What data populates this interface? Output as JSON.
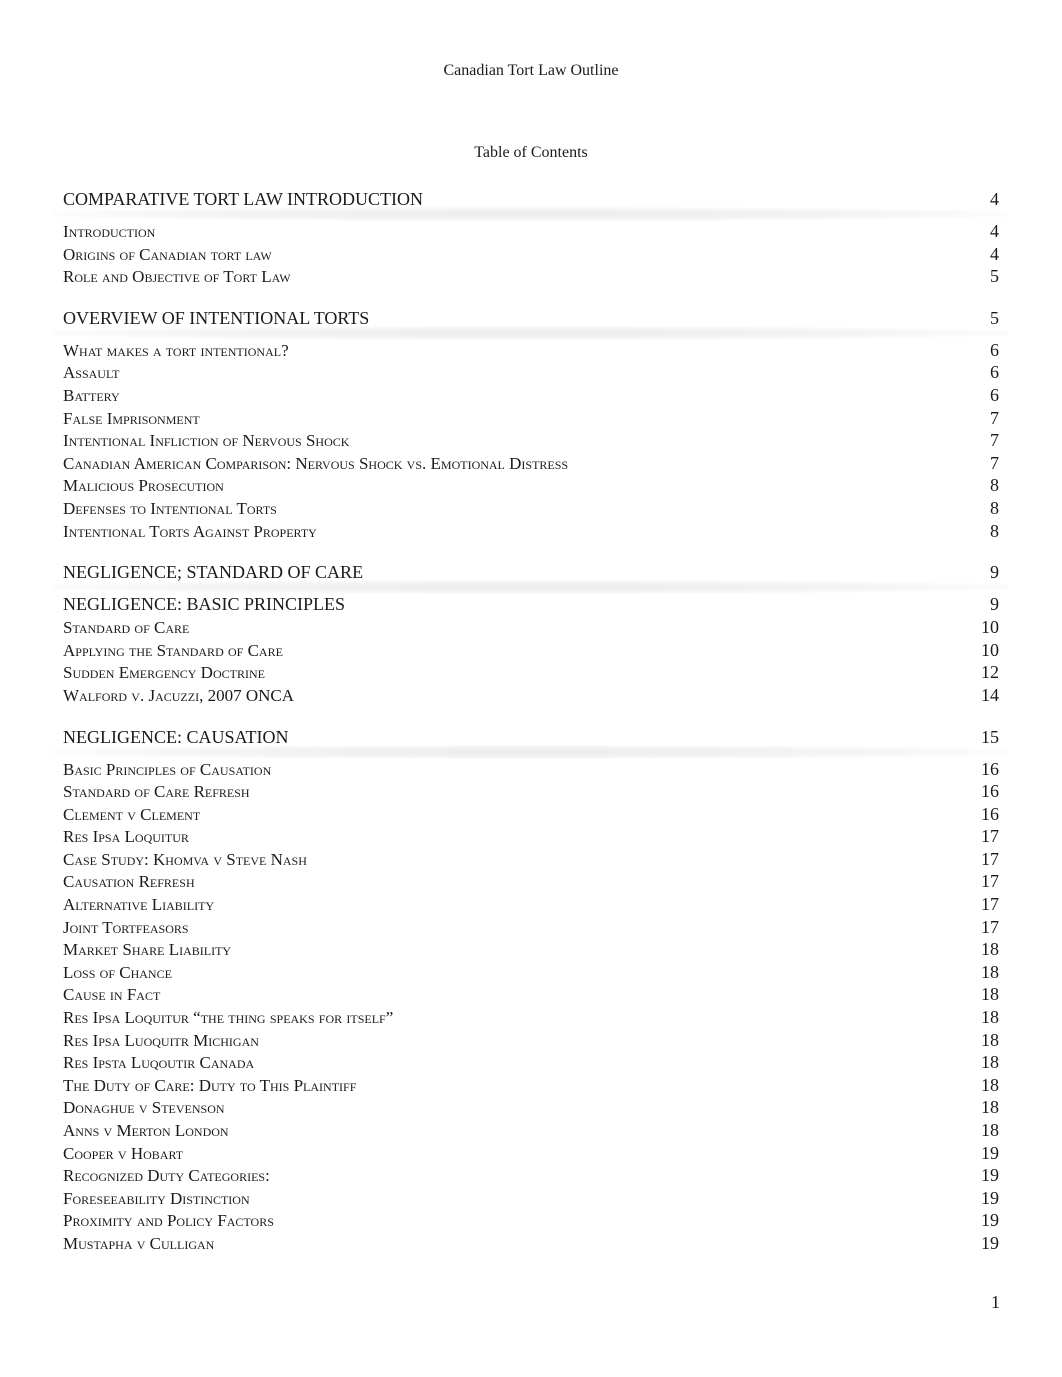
{
  "document": {
    "title": "Canadian Tort Law Outline",
    "toc_heading": "Table of Contents",
    "page_number": "1"
  },
  "toc": {
    "sections": [
      {
        "title": "COMPARATIVE TORT LAW INTRODUCTION",
        "page": "4",
        "entries": [
          {
            "label": "Introduction",
            "page": "4"
          },
          {
            "label": "Origins of Canadian tort law",
            "page": "4"
          },
          {
            "label": "Role and Objective of Tort Law",
            "page": "5"
          }
        ]
      },
      {
        "title": "OVERVIEW OF INTENTIONAL TORTS",
        "page": "5",
        "entries": [
          {
            "label": "What makes a tort intentional?",
            "page": "6"
          },
          {
            "label": "Assault",
            "page": "6"
          },
          {
            "label": "Battery",
            "page": "6"
          },
          {
            "label": "False Imprisonment",
            "page": "7"
          },
          {
            "label": "Intentional Infliction of Nervous Shock",
            "page": "7"
          },
          {
            "label": "Canadian American Comparison: Nervous Shock vs. Emotional Distress",
            "page": "7"
          },
          {
            "label": "Malicious Prosecution",
            "page": "8"
          },
          {
            "label": "Defenses to Intentional Torts",
            "page": "8"
          },
          {
            "label": "Intentional Torts Against Property",
            "page": "8"
          }
        ]
      },
      {
        "title": "NEGLIGENCE; STANDARD OF CARE",
        "page": "9",
        "subheading": {
          "title": "NEGLIGENCE: BASIC PRINCIPLES",
          "page": "9"
        },
        "entries": [
          {
            "label": "Standard of Care",
            "page": "10"
          },
          {
            "label": "Applying the Standard of Care",
            "page": "10"
          },
          {
            "label": "Sudden Emergency Doctrine",
            "page": "12"
          },
          {
            "label": "Walford v. Jacuzzi, 2007 ONCA",
            "page": "14"
          }
        ]
      },
      {
        "title": "NEGLIGENCE: CAUSATION",
        "page": "15",
        "entries": [
          {
            "label": "Basic Principles of Causation",
            "page": "16"
          },
          {
            "label": "Standard of Care Refresh",
            "page": "16"
          },
          {
            "label": "Clement v Clement",
            "page": "16"
          },
          {
            "label": "Res Ipsa Loquitur",
            "page": "17"
          },
          {
            "label": "Case Study: Khomva v Steve Nash",
            "page": "17"
          },
          {
            "label": "Causation Refresh",
            "page": "17"
          },
          {
            "label": "Alternative Liability",
            "page": "17"
          },
          {
            "label": "Joint Tortfeasors",
            "page": "17"
          },
          {
            "label": "Market Share Liability",
            "page": "18"
          },
          {
            "label": "Loss of Chance",
            "page": "18"
          },
          {
            "label": "Cause in Fact",
            "page": "18"
          },
          {
            "label": "Res Ipsa Loquitur “the thing speaks for itself”",
            "page": "18"
          },
          {
            "label": "Res Ipsa Luoquitr Michigan",
            "page": "18"
          },
          {
            "label": "Res Ipsta Luqoutir Canada",
            "page": "18"
          },
          {
            "label": "The Duty of Care: Duty to This Plaintiff",
            "page": "18"
          },
          {
            "label": "Donaghue v Stevenson",
            "page": "18"
          },
          {
            "label": "Anns v Merton London",
            "page": "18"
          },
          {
            "label": "Cooper v Hobart",
            "page": "19"
          },
          {
            "label": "Recognized Duty Categories:",
            "page": "19"
          },
          {
            "label": "Foreseeability Distinction",
            "page": "19"
          },
          {
            "label": "Proximity and Policy Factors",
            "page": "19"
          },
          {
            "label": "Mustapha v Culligan",
            "page": "19"
          }
        ]
      }
    ]
  }
}
